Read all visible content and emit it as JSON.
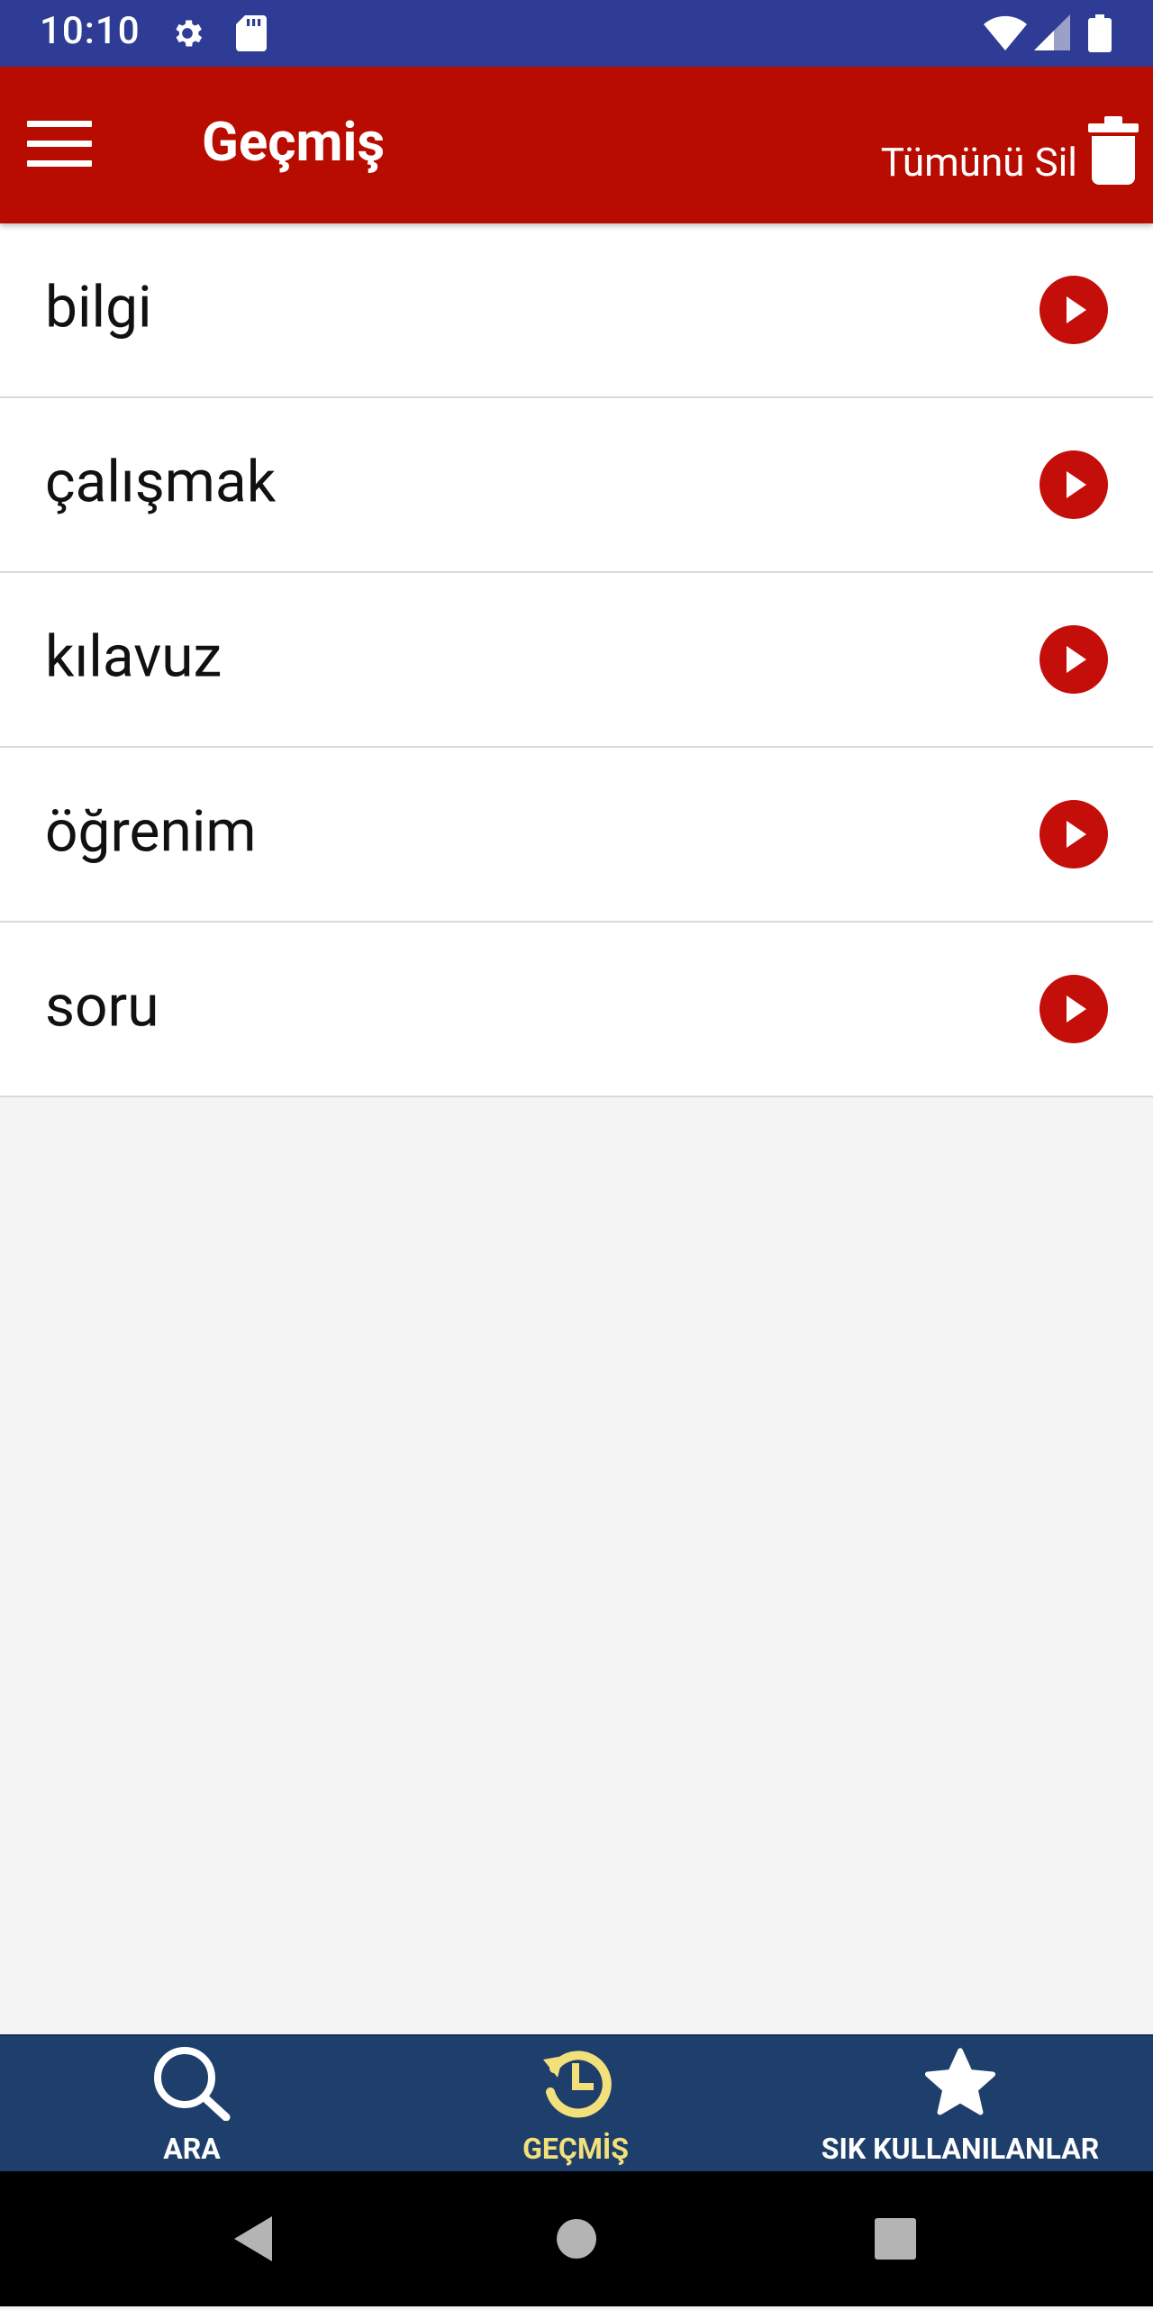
{
  "status_bar": {
    "time": "10:10",
    "left_icons": [
      "gear-icon",
      "sd-card-icon"
    ],
    "right_icons": [
      "wifi-icon",
      "cell-signal-icon",
      "battery-icon"
    ],
    "background": "#2f3c96"
  },
  "app_bar": {
    "title": "Geçmiş",
    "delete_all_label": "Tümünü Sil",
    "background": "#b80c00"
  },
  "history": {
    "items": [
      {
        "label": "bilgi"
      },
      {
        "label": "çalışmak"
      },
      {
        "label": "kılavuz"
      },
      {
        "label": "öğrenim"
      },
      {
        "label": "soru"
      }
    ],
    "play_color": "#c40e0a"
  },
  "bottom_nav": {
    "items": [
      {
        "label": "ARA",
        "icon": "search-icon",
        "active": false
      },
      {
        "label": "GEÇMİŞ",
        "icon": "history-icon",
        "active": true
      },
      {
        "label": "SIK KULLANILANLAR",
        "icon": "star-icon",
        "active": false
      }
    ],
    "background": "#1e3f6b",
    "active_color": "#f2e07a"
  },
  "system_nav": {
    "buttons": [
      "back-icon",
      "home-icon",
      "recents-icon"
    ]
  }
}
